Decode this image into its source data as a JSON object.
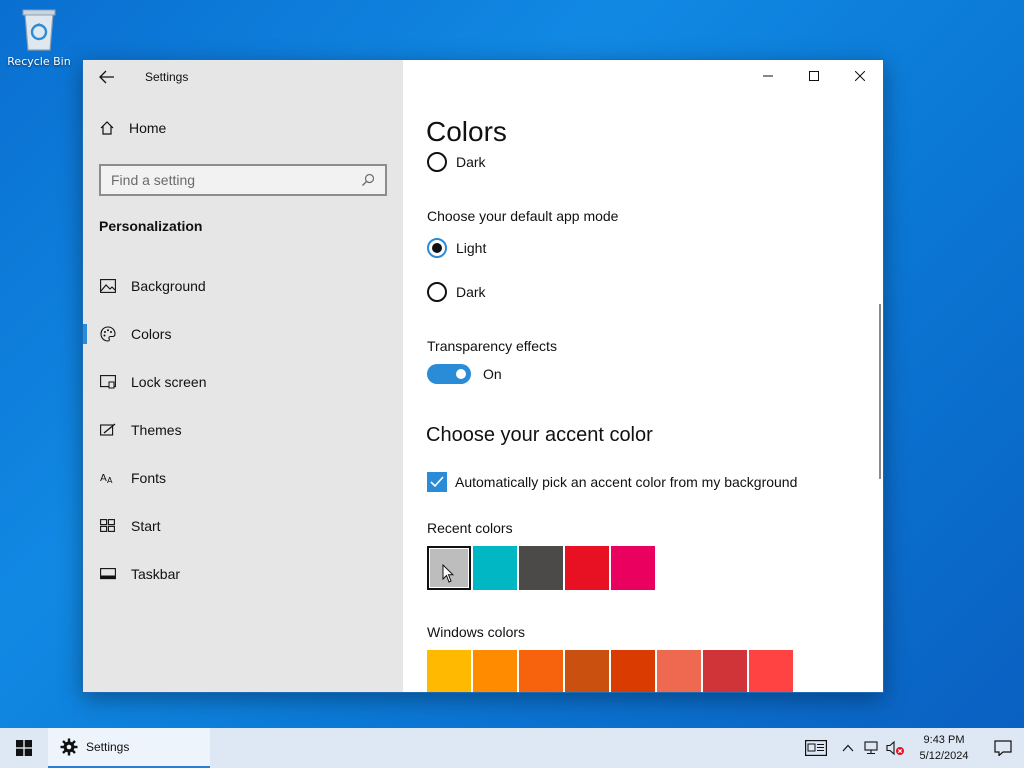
{
  "desktop": {
    "recycle_bin_label": "Recycle Bin"
  },
  "window": {
    "app_title": "Settings",
    "controls": {
      "minimize": "minimize",
      "maximize": "maximize",
      "close": "close"
    }
  },
  "nav": {
    "home_label": "Home",
    "search_placeholder": "Find a setting",
    "section_title": "Personalization",
    "items": [
      {
        "label": "Background",
        "icon": "image-icon"
      },
      {
        "label": "Colors",
        "icon": "palette-icon",
        "selected": true
      },
      {
        "label": "Lock screen",
        "icon": "lock-screen-icon"
      },
      {
        "label": "Themes",
        "icon": "themes-icon"
      },
      {
        "label": "Fonts",
        "icon": "fonts-icon"
      },
      {
        "label": "Start",
        "icon": "start-icon"
      },
      {
        "label": "Taskbar",
        "icon": "taskbar-icon"
      }
    ]
  },
  "content": {
    "title": "Colors",
    "windows_mode_dark_label": "Dark",
    "app_mode_heading": "Choose your default app mode",
    "app_mode_options": [
      "Light",
      "Dark"
    ],
    "app_mode_selected": "Light",
    "transparency_heading": "Transparency effects",
    "transparency_state": "On",
    "accent_heading": "Choose your accent color",
    "auto_accent_label": "Automatically pick an accent color from my background",
    "auto_accent_checked": true,
    "recent_colors_heading": "Recent colors",
    "recent_colors": [
      "#bdbdbd",
      "#00b7c3",
      "#4c4a48",
      "#e81123",
      "#ea005e"
    ],
    "windows_colors_heading": "Windows colors",
    "windows_colors": [
      "#ffb900",
      "#ff8c00",
      "#f7630c",
      "#ca5010",
      "#da3b01",
      "#ef6950",
      "#d13438",
      "#ff4343"
    ]
  },
  "taskbar": {
    "task_label": "Settings",
    "time": "9:43 PM",
    "date": "5/12/2024"
  },
  "colors": {
    "accent": "#2a8bd6",
    "nav_bg": "#e6e6e6"
  }
}
